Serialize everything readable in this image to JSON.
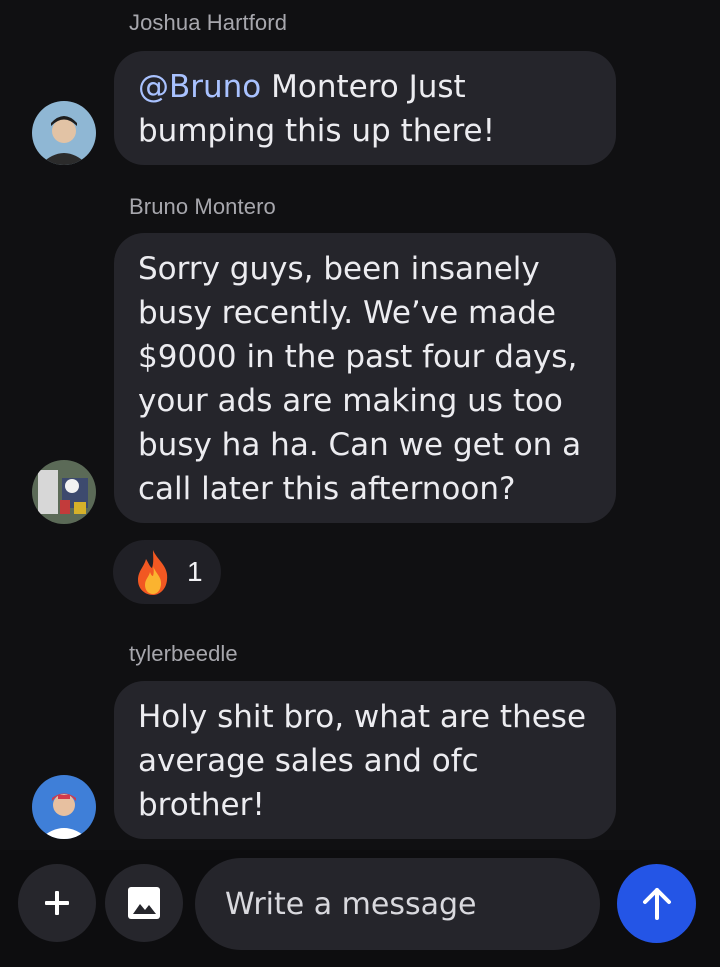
{
  "messages": [
    {
      "sender": "Joshua Hartford",
      "mention": "@Bruno",
      "text": " Montero Just bumping this up there!"
    },
    {
      "sender": "Bruno Montero",
      "text": "Sorry guys, been insanely busy recently. We’ve made $9000 in the past four days, your ads are making us too busy ha ha. Can we get on a call later this afternoon?",
      "reaction": {
        "icon": "fire-emoji",
        "count": "1"
      }
    },
    {
      "sender": "tylerbeedle",
      "text": "Holy shit bro, what are these average sales and ofc brother!"
    }
  ],
  "composer": {
    "placeholder": "Write a message",
    "add_icon": "plus-icon",
    "image_icon": "image-icon",
    "send_icon": "arrow-up-icon"
  },
  "colors": {
    "background": "#101012",
    "bubble": "#25252b",
    "mention": "#a9c2ff",
    "send_button": "#2455e6"
  }
}
